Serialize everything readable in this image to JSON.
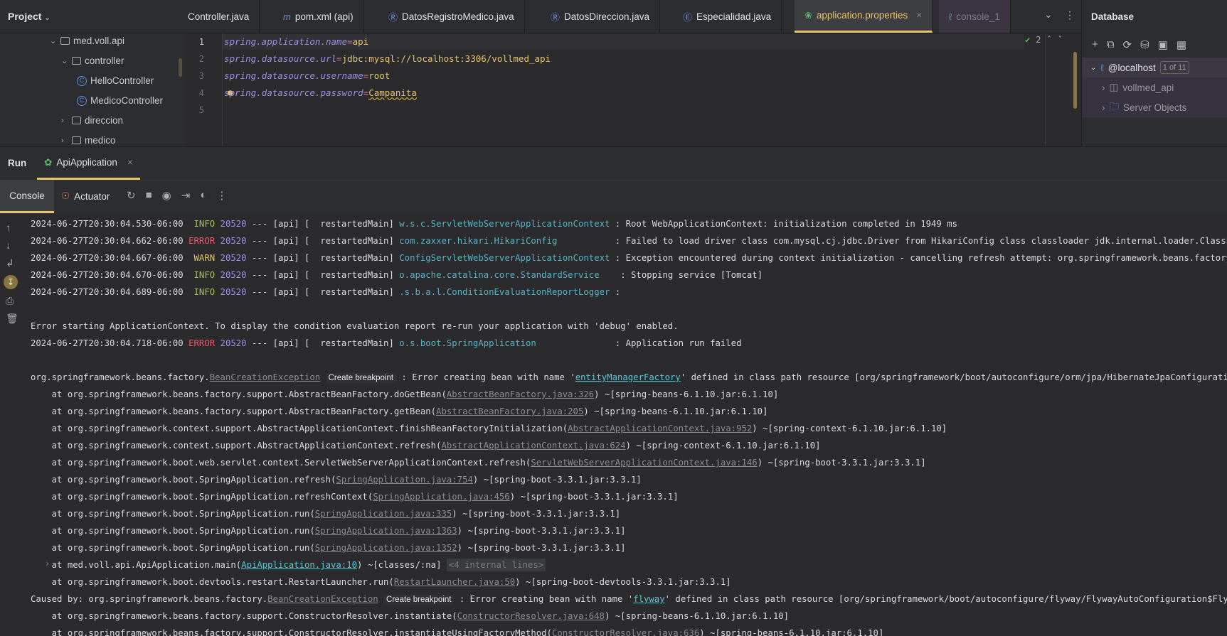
{
  "project": {
    "title": "Project",
    "tree": [
      {
        "label": "med.voll.api",
        "type": "folder",
        "expanded": true
      },
      {
        "label": "controller",
        "type": "folder",
        "expanded": true
      },
      {
        "label": "HelloController",
        "type": "class"
      },
      {
        "label": "MedicoController",
        "type": "class"
      },
      {
        "label": "direccion",
        "type": "folder",
        "expanded": false
      },
      {
        "label": "medico",
        "type": "folder",
        "expanded": false
      }
    ]
  },
  "tabs": [
    {
      "label": "Controller.java",
      "icon": ""
    },
    {
      "label": "pom.xml (api)",
      "icon": "m"
    },
    {
      "label": "DatosRegistroMedico.java",
      "icon": "R"
    },
    {
      "label": "DatosDireccion.java",
      "icon": "R"
    },
    {
      "label": "Especialidad.java",
      "icon": "E"
    },
    {
      "label": "application.properties",
      "icon": "spring",
      "active": true
    },
    {
      "label": "console_1",
      "icon": "mysql",
      "dim": true
    }
  ],
  "editor": {
    "lines": [
      {
        "n": "1",
        "key": "spring.application.name",
        "val": "api"
      },
      {
        "n": "2",
        "key": "spring.datasource.url",
        "val": "jdbc:mysql://localhost:3306/vollmed_api"
      },
      {
        "n": "3",
        "key": "spring.datasource.username",
        "val": "root"
      },
      {
        "n": "4",
        "key": "spring.datasource.password",
        "val": "Campanita"
      },
      {
        "n": "5",
        "key": "",
        "val": ""
      }
    ],
    "inspections": "2"
  },
  "database": {
    "title": "Database",
    "host": "@localhost",
    "host_badge": "1 of 11",
    "items": [
      "vollmed_api",
      "Server Objects"
    ]
  },
  "run": {
    "label": "Run",
    "tab": "ApiApplication",
    "console_tab": "Console",
    "actuator": "Actuator"
  },
  "colors": {
    "accent": "#e8c46a",
    "info": "#a5c25c",
    "error": "#f75464",
    "warn": "#e0c46c",
    "logger": "#56b3c6"
  },
  "console": [
    [
      [
        "2024-06-27T20:30:04.530-06:00  ",
        "ts"
      ],
      [
        "INFO",
        "info"
      ],
      [
        " 20520",
        "pid"
      ],
      [
        " --- [api] [  restartedMain] ",
        "ts"
      ],
      [
        "w.s.c.ServletWebServerApplicationContext",
        "logger"
      ],
      [
        " : Root WebApplicationContext: initialization completed in 1949 ms",
        "ts"
      ]
    ],
    [
      [
        "2024-06-27T20:30:04.662-06:00 ",
        "ts"
      ],
      [
        "ERROR",
        "error"
      ],
      [
        " 20520",
        "pid"
      ],
      [
        " --- [api] [  restartedMain] ",
        "ts"
      ],
      [
        "com.zaxxer.hikari.HikariConfig          ",
        "logger"
      ],
      [
        " : Failed to load driver class com.mysql.cj.jdbc.Driver from HikariConfig class classloader jdk.internal.loader.ClassLoaders$AppCla",
        "ts"
      ]
    ],
    [
      [
        "2024-06-27T20:30:04.667-06:00  ",
        "ts"
      ],
      [
        "WARN",
        "warn"
      ],
      [
        " 20520",
        "pid"
      ],
      [
        " --- [api] [  restartedMain] ",
        "ts"
      ],
      [
        "ConfigServletWebServerApplicationContext",
        "logger"
      ],
      [
        " : Exception encountered during context initialization - cancelling refresh attempt: org.springframework.beans.factory.BeanCreation",
        "ts"
      ]
    ],
    [
      [
        "2024-06-27T20:30:04.670-06:00  ",
        "ts"
      ],
      [
        "INFO",
        "info"
      ],
      [
        " 20520",
        "pid"
      ],
      [
        " --- [api] [  restartedMain] ",
        "ts"
      ],
      [
        "o.apache.catalina.core.StandardService   ",
        "logger"
      ],
      [
        " : Stopping service [Tomcat]",
        "ts"
      ]
    ],
    [
      [
        "2024-06-27T20:30:04.689-06:00  ",
        "ts"
      ],
      [
        "INFO",
        "info"
      ],
      [
        " 20520",
        "pid"
      ],
      [
        " --- [api] [  restartedMain] ",
        "ts"
      ],
      [
        ".s.b.a.l.ConditionEvaluationReportLogger",
        "logger"
      ],
      [
        " :",
        "ts"
      ]
    ],
    [],
    [
      [
        "Error starting ApplicationContext. To display the condition evaluation report re-run your application with 'debug' enabled.",
        "ts"
      ]
    ],
    [
      [
        "2024-06-27T20:30:04.718-06:00 ",
        "ts"
      ],
      [
        "ERROR",
        "error"
      ],
      [
        " 20520",
        "pid"
      ],
      [
        " --- [api] [  restartedMain] ",
        "ts"
      ],
      [
        "o.s.boot.SpringApplication              ",
        "logger"
      ],
      [
        " : Application run failed",
        "ts"
      ]
    ],
    [],
    [
      [
        "org.springframework.beans.factory.",
        "ts"
      ],
      [
        "BeanCreationException",
        "link"
      ],
      [
        " ",
        "ts"
      ],
      [
        "Create breakpoint",
        "badge"
      ],
      [
        " : Error creating bean with name '",
        "ts"
      ],
      [
        "entityManagerFactory",
        "hlink"
      ],
      [
        "' defined in class path resource [org/springframework/boot/autoconfigure/orm/jpa/HibernateJpaConfiguration.class]: Fa",
        "ts"
      ]
    ],
    [
      [
        "    at org.springframework.beans.factory.support.AbstractBeanFactory.doGetBean(",
        "ts"
      ],
      [
        "AbstractBeanFactory.java:326",
        "link"
      ],
      [
        ") ~[spring-beans-6.1.10.jar:6.1.10]",
        "ts"
      ]
    ],
    [
      [
        "    at org.springframework.beans.factory.support.AbstractBeanFactory.getBean(",
        "ts"
      ],
      [
        "AbstractBeanFactory.java:205",
        "link"
      ],
      [
        ") ~[spring-beans-6.1.10.jar:6.1.10]",
        "ts"
      ]
    ],
    [
      [
        "    at org.springframework.context.support.AbstractApplicationContext.finishBeanFactoryInitialization(",
        "ts"
      ],
      [
        "AbstractApplicationContext.java:952",
        "link"
      ],
      [
        ") ~[spring-context-6.1.10.jar:6.1.10]",
        "ts"
      ]
    ],
    [
      [
        "    at org.springframework.context.support.AbstractApplicationContext.refresh(",
        "ts"
      ],
      [
        "AbstractApplicationContext.java:624",
        "link"
      ],
      [
        ") ~[spring-context-6.1.10.jar:6.1.10]",
        "ts"
      ]
    ],
    [
      [
        "    at org.springframework.boot.web.servlet.context.ServletWebServerApplicationContext.refresh(",
        "ts"
      ],
      [
        "ServletWebServerApplicationContext.java:146",
        "link"
      ],
      [
        ") ~[spring-boot-3.3.1.jar:3.3.1]",
        "ts"
      ]
    ],
    [
      [
        "    at org.springframework.boot.SpringApplication.refresh(",
        "ts"
      ],
      [
        "SpringApplication.java:754",
        "link"
      ],
      [
        ") ~[spring-boot-3.3.1.jar:3.3.1]",
        "ts"
      ]
    ],
    [
      [
        "    at org.springframework.boot.SpringApplication.refreshContext(",
        "ts"
      ],
      [
        "SpringApplication.java:456",
        "link"
      ],
      [
        ") ~[spring-boot-3.3.1.jar:3.3.1]",
        "ts"
      ]
    ],
    [
      [
        "    at org.springframework.boot.SpringApplication.run(",
        "ts"
      ],
      [
        "SpringApplication.java:335",
        "link"
      ],
      [
        ") ~[spring-boot-3.3.1.jar:3.3.1]",
        "ts"
      ]
    ],
    [
      [
        "    at org.springframework.boot.SpringApplication.run(",
        "ts"
      ],
      [
        "SpringApplication.java:1363",
        "link"
      ],
      [
        ") ~[spring-boot-3.3.1.jar:3.3.1]",
        "ts"
      ]
    ],
    [
      [
        "    at org.springframework.boot.SpringApplication.run(",
        "ts"
      ],
      [
        "SpringApplication.java:1352",
        "link"
      ],
      [
        ") ~[spring-boot-3.3.1.jar:3.3.1]",
        "ts"
      ]
    ],
    [
      [
        "    at med.voll.api.ApiApplication.main(",
        "ts"
      ],
      [
        "ApiApplication.java:10",
        "hlink"
      ],
      [
        ") ~[classes/:na] ",
        "ts"
      ],
      [
        "<4 internal lines>",
        "dimbox"
      ]
    ],
    [
      [
        "    at org.springframework.boot.devtools.restart.RestartLauncher.run(",
        "ts"
      ],
      [
        "RestartLauncher.java:50",
        "link"
      ],
      [
        ") ~[spring-boot-devtools-3.3.1.jar:3.3.1]",
        "ts"
      ]
    ],
    [
      [
        "Caused by: org.springframework.beans.factory.",
        "ts"
      ],
      [
        "BeanCreationException",
        "link"
      ],
      [
        " ",
        "ts"
      ],
      [
        "Create breakpoint",
        "badge"
      ],
      [
        " : Error creating bean with name '",
        "ts"
      ],
      [
        "flyway",
        "hlink"
      ],
      [
        "' defined in class path resource [org/springframework/boot/autoconfigure/flyway/FlywayAutoConfiguration$FlywayConfigurat",
        "ts"
      ]
    ],
    [
      [
        "    at org.springframework.beans.factory.support.ConstructorResolver.instantiate(",
        "ts"
      ],
      [
        "ConstructorResolver.java:648",
        "link"
      ],
      [
        ") ~[spring-beans-6.1.10.jar:6.1.10]",
        "ts"
      ]
    ],
    [
      [
        "    at org.springframework.beans.factory.support.ConstructorResolver.instantiateUsingFactoryMethod(",
        "ts"
      ],
      [
        "ConstructorResolver.java:636",
        "link"
      ],
      [
        ") ~[spring-beans-6.1.10.jar:6.1.10]",
        "ts"
      ]
    ]
  ]
}
